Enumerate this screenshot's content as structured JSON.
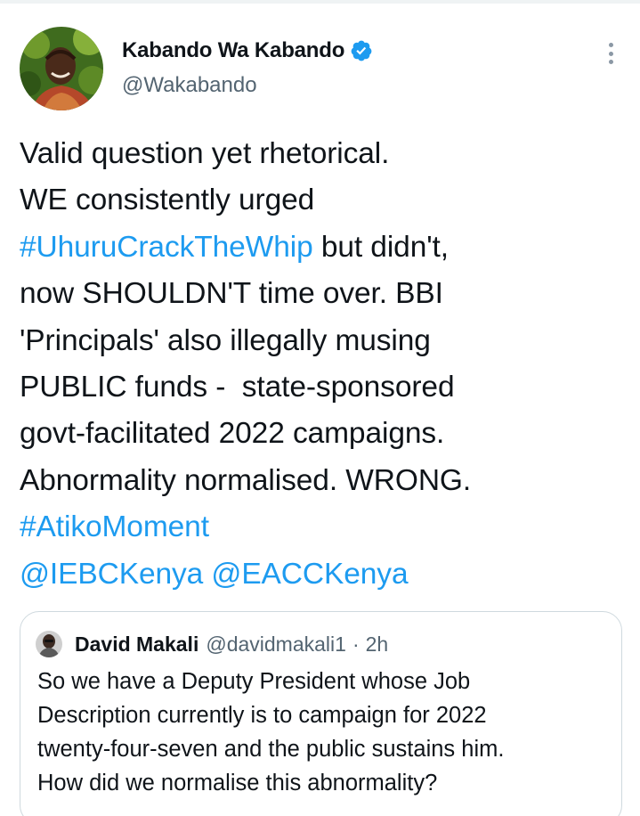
{
  "author": {
    "display_name": "Kabando Wa Kabando",
    "handle": "@Wakabando",
    "verified": true,
    "avatar_icon": "profile-photo"
  },
  "menu_icon": "more-options-icon",
  "tweet": {
    "lines": [
      [
        {
          "t": "Valid question yet rhetorical.",
          "link": false
        }
      ],
      [
        {
          "t": "WE consistently urged",
          "link": false
        }
      ],
      [
        {
          "t": "#UhuruCrackTheWhip",
          "link": true
        },
        {
          "t": " but didn't,",
          "link": false
        }
      ],
      [
        {
          "t": "now SHOULDN'T time over. BBI",
          "link": false
        }
      ],
      [
        {
          "t": "'Principals' also illegally musing",
          "link": false
        }
      ],
      [
        {
          "t": "PUBLIC funds -  state-sponsored",
          "link": false
        }
      ],
      [
        {
          "t": "govt-facilitated 2022 campaigns.",
          "link": false
        }
      ],
      [
        {
          "t": "Abnormality normalised. WRONG.",
          "link": false
        }
      ],
      [
        {
          "t": "#AtikoMoment",
          "link": true
        }
      ],
      [
        {
          "t": "@IEBCKenya",
          "link": true
        },
        {
          "t": " ",
          "link": false
        },
        {
          "t": "@EACCKenya",
          "link": true
        }
      ]
    ]
  },
  "quoted_tweet": {
    "display_name": "David Makali",
    "handle": "@davidmakali1",
    "separator": "·",
    "time": "2h",
    "lines": [
      "So we have a Deputy President whose Job",
      "Description currently is to campaign for 2022",
      "twenty-four-seven and the public sustains him.",
      "How did we normalise this abnormality?"
    ]
  },
  "colors": {
    "link": "#1d9bf0",
    "text": "#0f1419",
    "secondary": "#536471",
    "border": "#cfd9de",
    "verified": "#1d9bf0"
  }
}
